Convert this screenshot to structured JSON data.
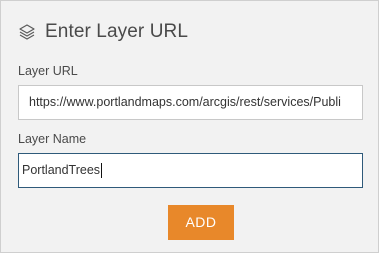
{
  "header": {
    "title": "Enter Layer URL",
    "icon": "layers-icon"
  },
  "form": {
    "layer_url_label": "Layer URL",
    "layer_url_value": "https://www.portlandmaps.com/arcgis/rest/services/Publi",
    "layer_name_label": "Layer Name",
    "layer_name_value": "PortlandTrees"
  },
  "actions": {
    "add_label": "ADD"
  },
  "colors": {
    "accent": "#e8882a",
    "panel": "#f2f2f2",
    "focus_border": "#2f5a7a"
  }
}
